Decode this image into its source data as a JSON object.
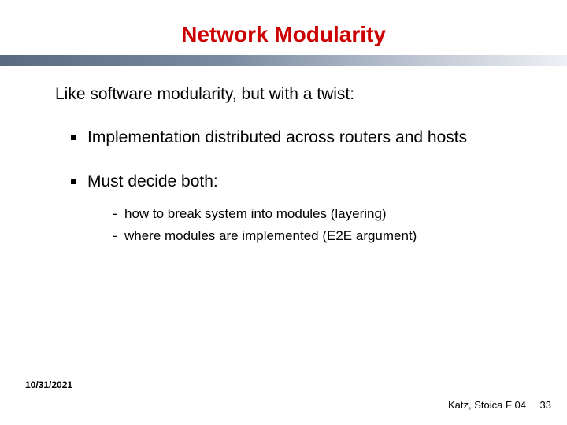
{
  "title": "Network Modularity",
  "lead": "Like software modularity, but with a twist:",
  "bullets": [
    {
      "text": "Implementation distributed across routers and hosts"
    },
    {
      "text": "Must decide both:",
      "sub": [
        "how to break system into modules (layering)",
        "where modules are implemented (E2E argument)"
      ]
    }
  ],
  "footer": {
    "date": "10/31/2021",
    "attribution": "Katz, Stoica F 04",
    "page": "33"
  }
}
